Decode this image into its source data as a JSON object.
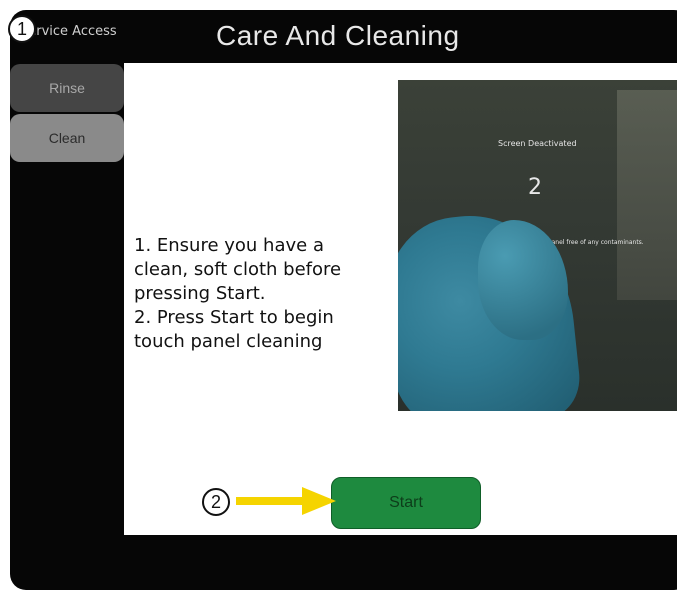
{
  "header": {
    "back_label": "Service Access",
    "title": "Care And Cleaning"
  },
  "sidebar": {
    "items": [
      {
        "label": "Rinse"
      },
      {
        "label": "Clean"
      }
    ]
  },
  "main": {
    "instructions": "1. Ensure you have a\nclean, soft cloth before\npressing Start.\n2. Press Start to begin\ntouch panel cleaning",
    "photo": {
      "screen_text": "Screen Deactivated",
      "countdown": "2",
      "caption": "uch panel free of any contaminants."
    },
    "start_label": "Start"
  },
  "callouts": {
    "one": "1",
    "two": "2"
  },
  "colors": {
    "panel": "#060606",
    "start_button": "#1e8a3f",
    "arrow": "#f5d400"
  }
}
